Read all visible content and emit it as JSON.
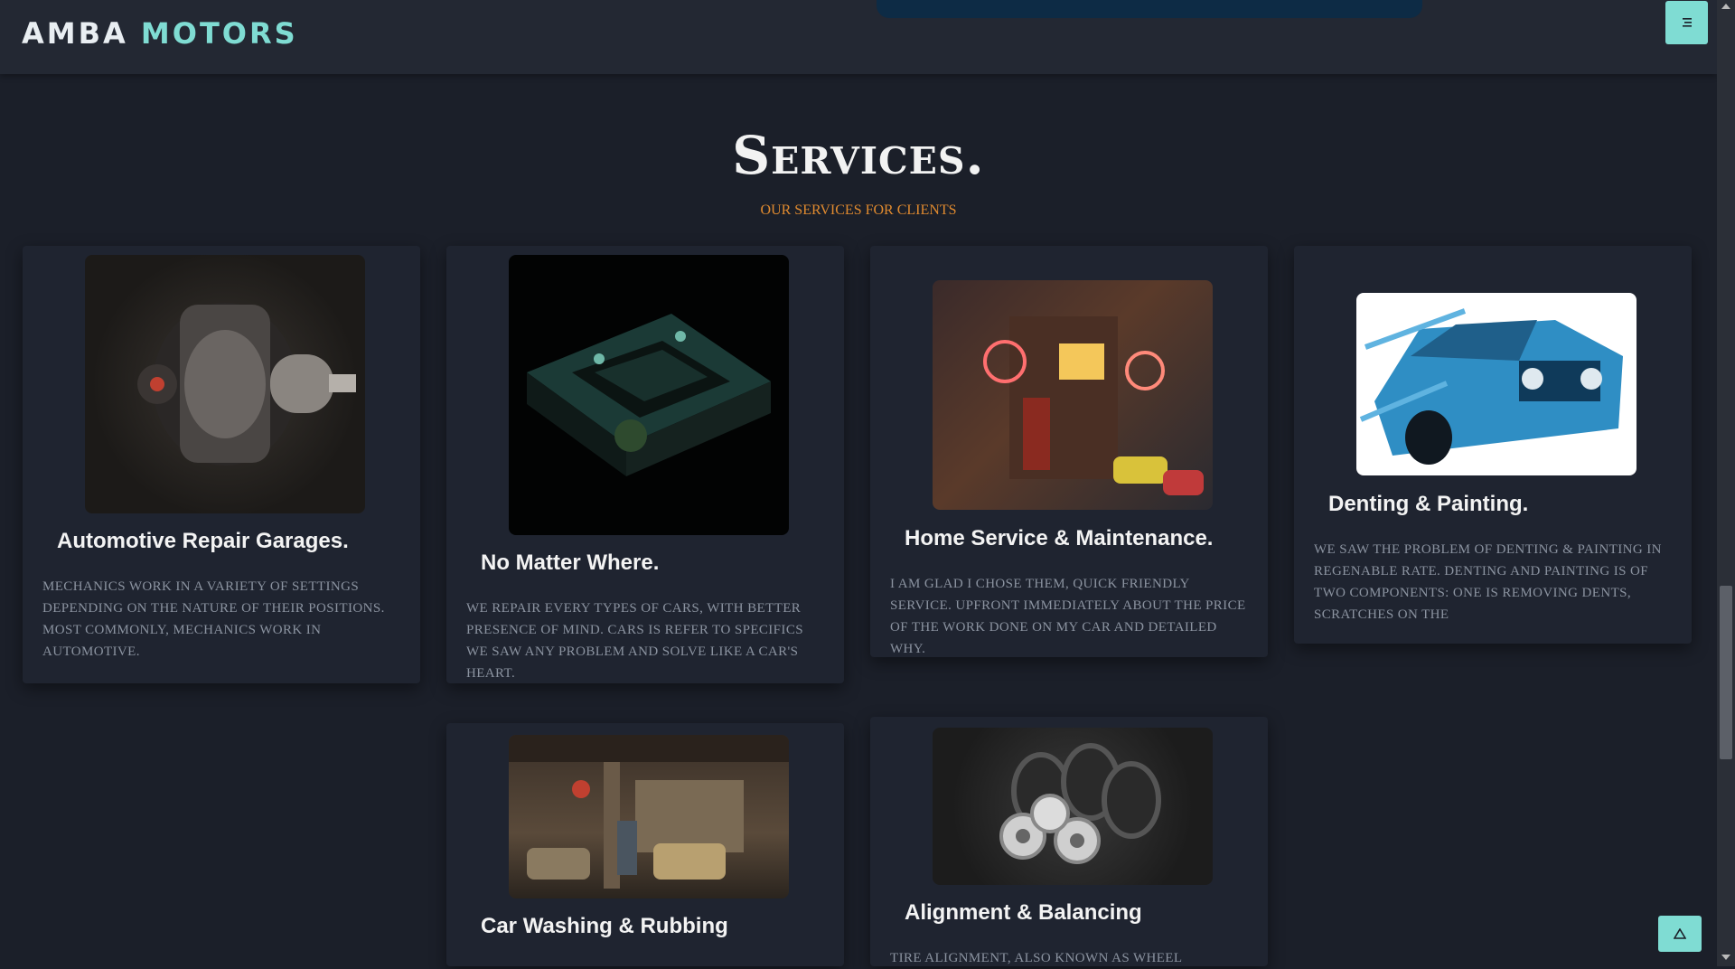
{
  "header": {
    "logo_part1": "AMBA",
    "logo_part2": "MOTORS"
  },
  "section": {
    "title": "Services.",
    "subtitle": "OUR SERVICES FOR CLIENTS"
  },
  "cards": [
    {
      "title": "Automotive Repair Garages.",
      "text": "Mechanics work in a variety of settings depending on the nature of their positions. Most commonly, mechanics work in automotive.",
      "image": "engine-image"
    },
    {
      "title": "No Matter Where.",
      "text": "We repair every types of cars, with better presence of mind. Cars is refer to specifics we saw any problem and solve like a car's heart.",
      "image": "isometric-car-image"
    },
    {
      "title": "Home Service & Maintenance.",
      "text": "I am glad I chose them, quick friendly service. Upfront immediately about the price of the work done on my car and detailed why.",
      "image": "neon-garage-image"
    },
    {
      "title": "Denting & Painting.",
      "text": "We saw the problem of denting & painting in regenable rate. Denting and painting is of two components: one is removing dents, scratches on the",
      "image": "blue-car-sketch-image"
    },
    {
      "title": "Car Washing & Rubbing",
      "text": "",
      "image": "car-wash-garage-image"
    },
    {
      "title": "Alignment & Balancing",
      "text": "Tire alignment, also known as wheel",
      "image": "tires-wheels-image"
    }
  ],
  "colors": {
    "accent": "#7fdcd3",
    "subtitle": "#e08a2f",
    "background": "#1b1f29"
  },
  "icons": {
    "menu": "menu-icon",
    "back_to_top": "triangle-up-icon"
  }
}
